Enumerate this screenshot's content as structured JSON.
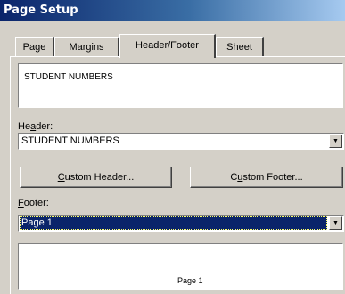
{
  "window": {
    "title": "Page Setup"
  },
  "tabs": [
    {
      "label": "Page"
    },
    {
      "label": "Margins"
    },
    {
      "label": "Header/Footer",
      "active": true
    },
    {
      "label": "Sheet"
    }
  ],
  "header_preview": {
    "text": "STUDENT NUMBERS"
  },
  "header": {
    "label": "Header:",
    "value": "STUDENT NUMBERS"
  },
  "buttons": {
    "custom_header": "Custom Header...",
    "custom_footer": "Custom Footer..."
  },
  "footer": {
    "label": "Footer:",
    "value": "Page 1"
  },
  "footer_preview": {
    "text": "Page 1"
  },
  "colors": {
    "title_bar": "#0a246a",
    "selection": "#0a246a",
    "face": "#d4d0c8"
  }
}
